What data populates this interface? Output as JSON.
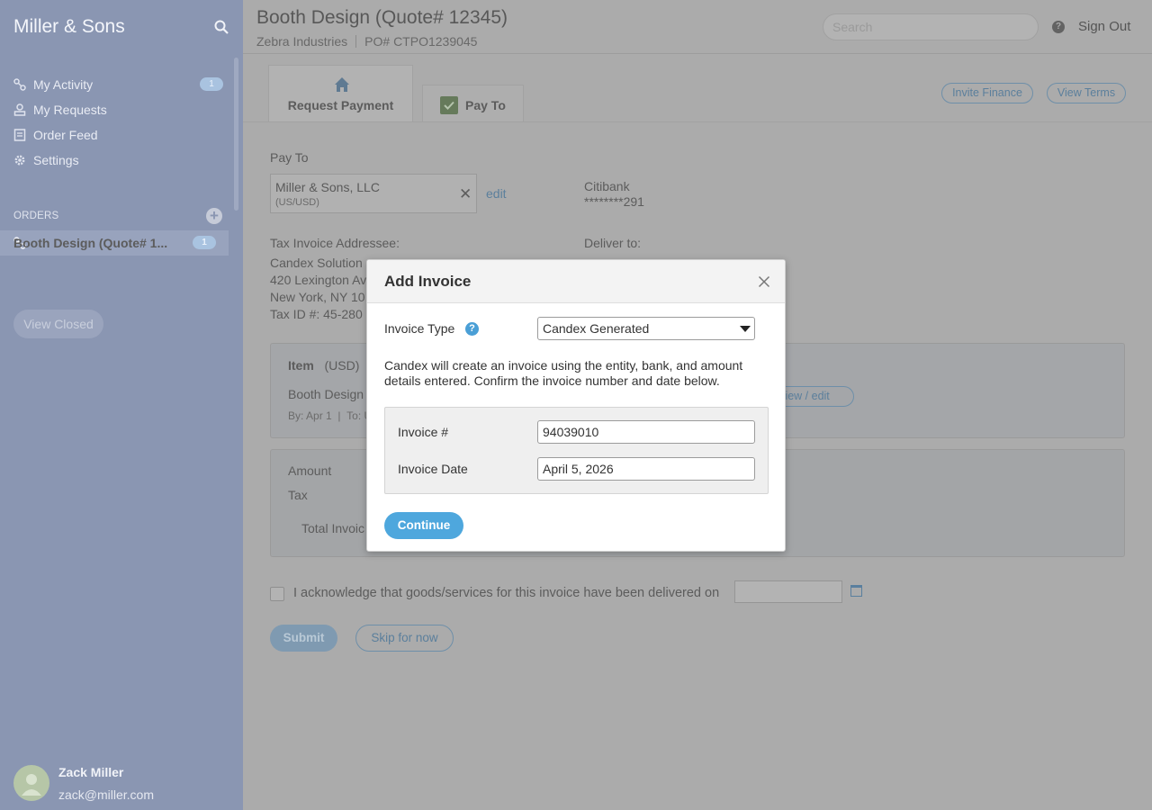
{
  "sidebar": {
    "title": "Miller & Sons",
    "nav": [
      {
        "label": "My Activity",
        "badge": "1"
      },
      {
        "label": "My Requests"
      },
      {
        "label": "Order Feed"
      },
      {
        "label": "Settings"
      }
    ],
    "orders_heading": "ORDERS",
    "order_item": {
      "label": "Booth Design (Quote# 1...",
      "badge": "1"
    },
    "view_closed": "View Closed",
    "user": {
      "name": "Zack Miller",
      "email": "zack@miller.com"
    }
  },
  "header": {
    "title": "Booth Design (Quote# 12345)",
    "company": "Zebra Industries",
    "po": "PO# CTPO1239045",
    "search_placeholder": "Search",
    "sign_out": "Sign Out"
  },
  "tabs": [
    {
      "label": "Request Payment",
      "active": true
    },
    {
      "label": "Pay To",
      "active": false
    }
  ],
  "actions": {
    "invite_finance": "Invite Finance",
    "view_terms": "View Terms"
  },
  "pay_to": {
    "label": "Pay To",
    "name": "Miller & Sons, LLC",
    "currency": "(US/USD)",
    "edit": "edit",
    "bank": "Citibank",
    "account": "********291"
  },
  "addressee": {
    "label": "Tax Invoice Addressee:",
    "lines": [
      "Candex Solution",
      "420 Lexington Av",
      "New York, NY 10",
      "Tax ID #: 45-280"
    ]
  },
  "deliver_to": {
    "label": "Deliver to:"
  },
  "item_card": {
    "heading": "Item",
    "currency": "(USD)",
    "name": "Booth Design",
    "meta_by": "By: Apr 1",
    "meta_to": "To: U",
    "view_edit": "view / edit"
  },
  "amount_card": {
    "amount": "Amount",
    "tax": "Tax",
    "total": "Total Invoic"
  },
  "acknowledge": {
    "text": "I acknowledge that goods/services for this invoice have been delivered on"
  },
  "buttons": {
    "submit": "Submit",
    "skip": "Skip for now"
  },
  "modal": {
    "title": "Add Invoice",
    "invoice_type_label": "Invoice Type",
    "invoice_type_value": "Candex Generated",
    "description": "Candex will create an invoice using the entity, bank, and amount details entered. Confirm the invoice number and date below.",
    "invoice_number_label": "Invoice #",
    "invoice_number_value": "94039010",
    "invoice_date_label": "Invoice Date",
    "invoice_date_value": "April 5, 2026",
    "continue": "Continue"
  },
  "icons": [
    "search-icon",
    "activity-icon",
    "requests-icon",
    "order-feed-icon",
    "settings-icon",
    "add-icon",
    "home-icon",
    "check-icon",
    "help-icon",
    "close-icon",
    "calendar-icon",
    "chevron-down-icon",
    "avatar"
  ],
  "colors": {
    "sidebar": "#8a96b2",
    "accent": "#4ea7dd",
    "overlay": "#ababab"
  }
}
